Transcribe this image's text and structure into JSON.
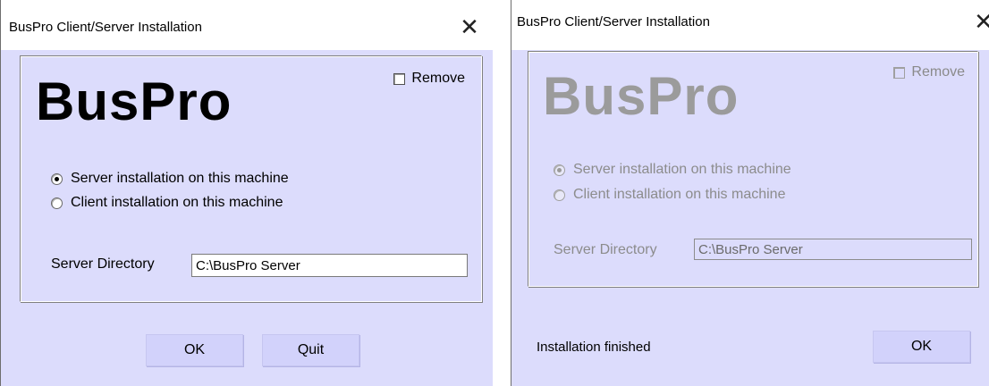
{
  "dialog_install": {
    "title": "BusPro Client/Server Installation",
    "close_glyph": "✕",
    "logo": "BusPro",
    "remove_label": "Remove",
    "options": [
      {
        "label": "Server installation on this machine",
        "selected": true
      },
      {
        "label": "Client installation on this machine",
        "selected": false
      }
    ],
    "server_directory_label": "Server Directory",
    "server_directory_value": "C:\\BusPro Server",
    "ok_label": "OK",
    "quit_label": "Quit"
  },
  "dialog_finished": {
    "title": "BusPro Client/Server Installation",
    "close_glyph": "✕",
    "logo": "BusPro",
    "remove_label": "Remove",
    "options": [
      {
        "label": "Server installation on this machine",
        "selected": true
      },
      {
        "label": "Client installation on this machine",
        "selected": false
      }
    ],
    "server_directory_label": "Server Directory",
    "server_directory_value": "C:\\BusPro Server",
    "status_text": "Installation finished",
    "ok_label": "OK"
  },
  "colors": {
    "dialog_background": "#dcdcfc",
    "button_background": "#d2d2fb",
    "disabled_text": "#8c8c8c"
  }
}
